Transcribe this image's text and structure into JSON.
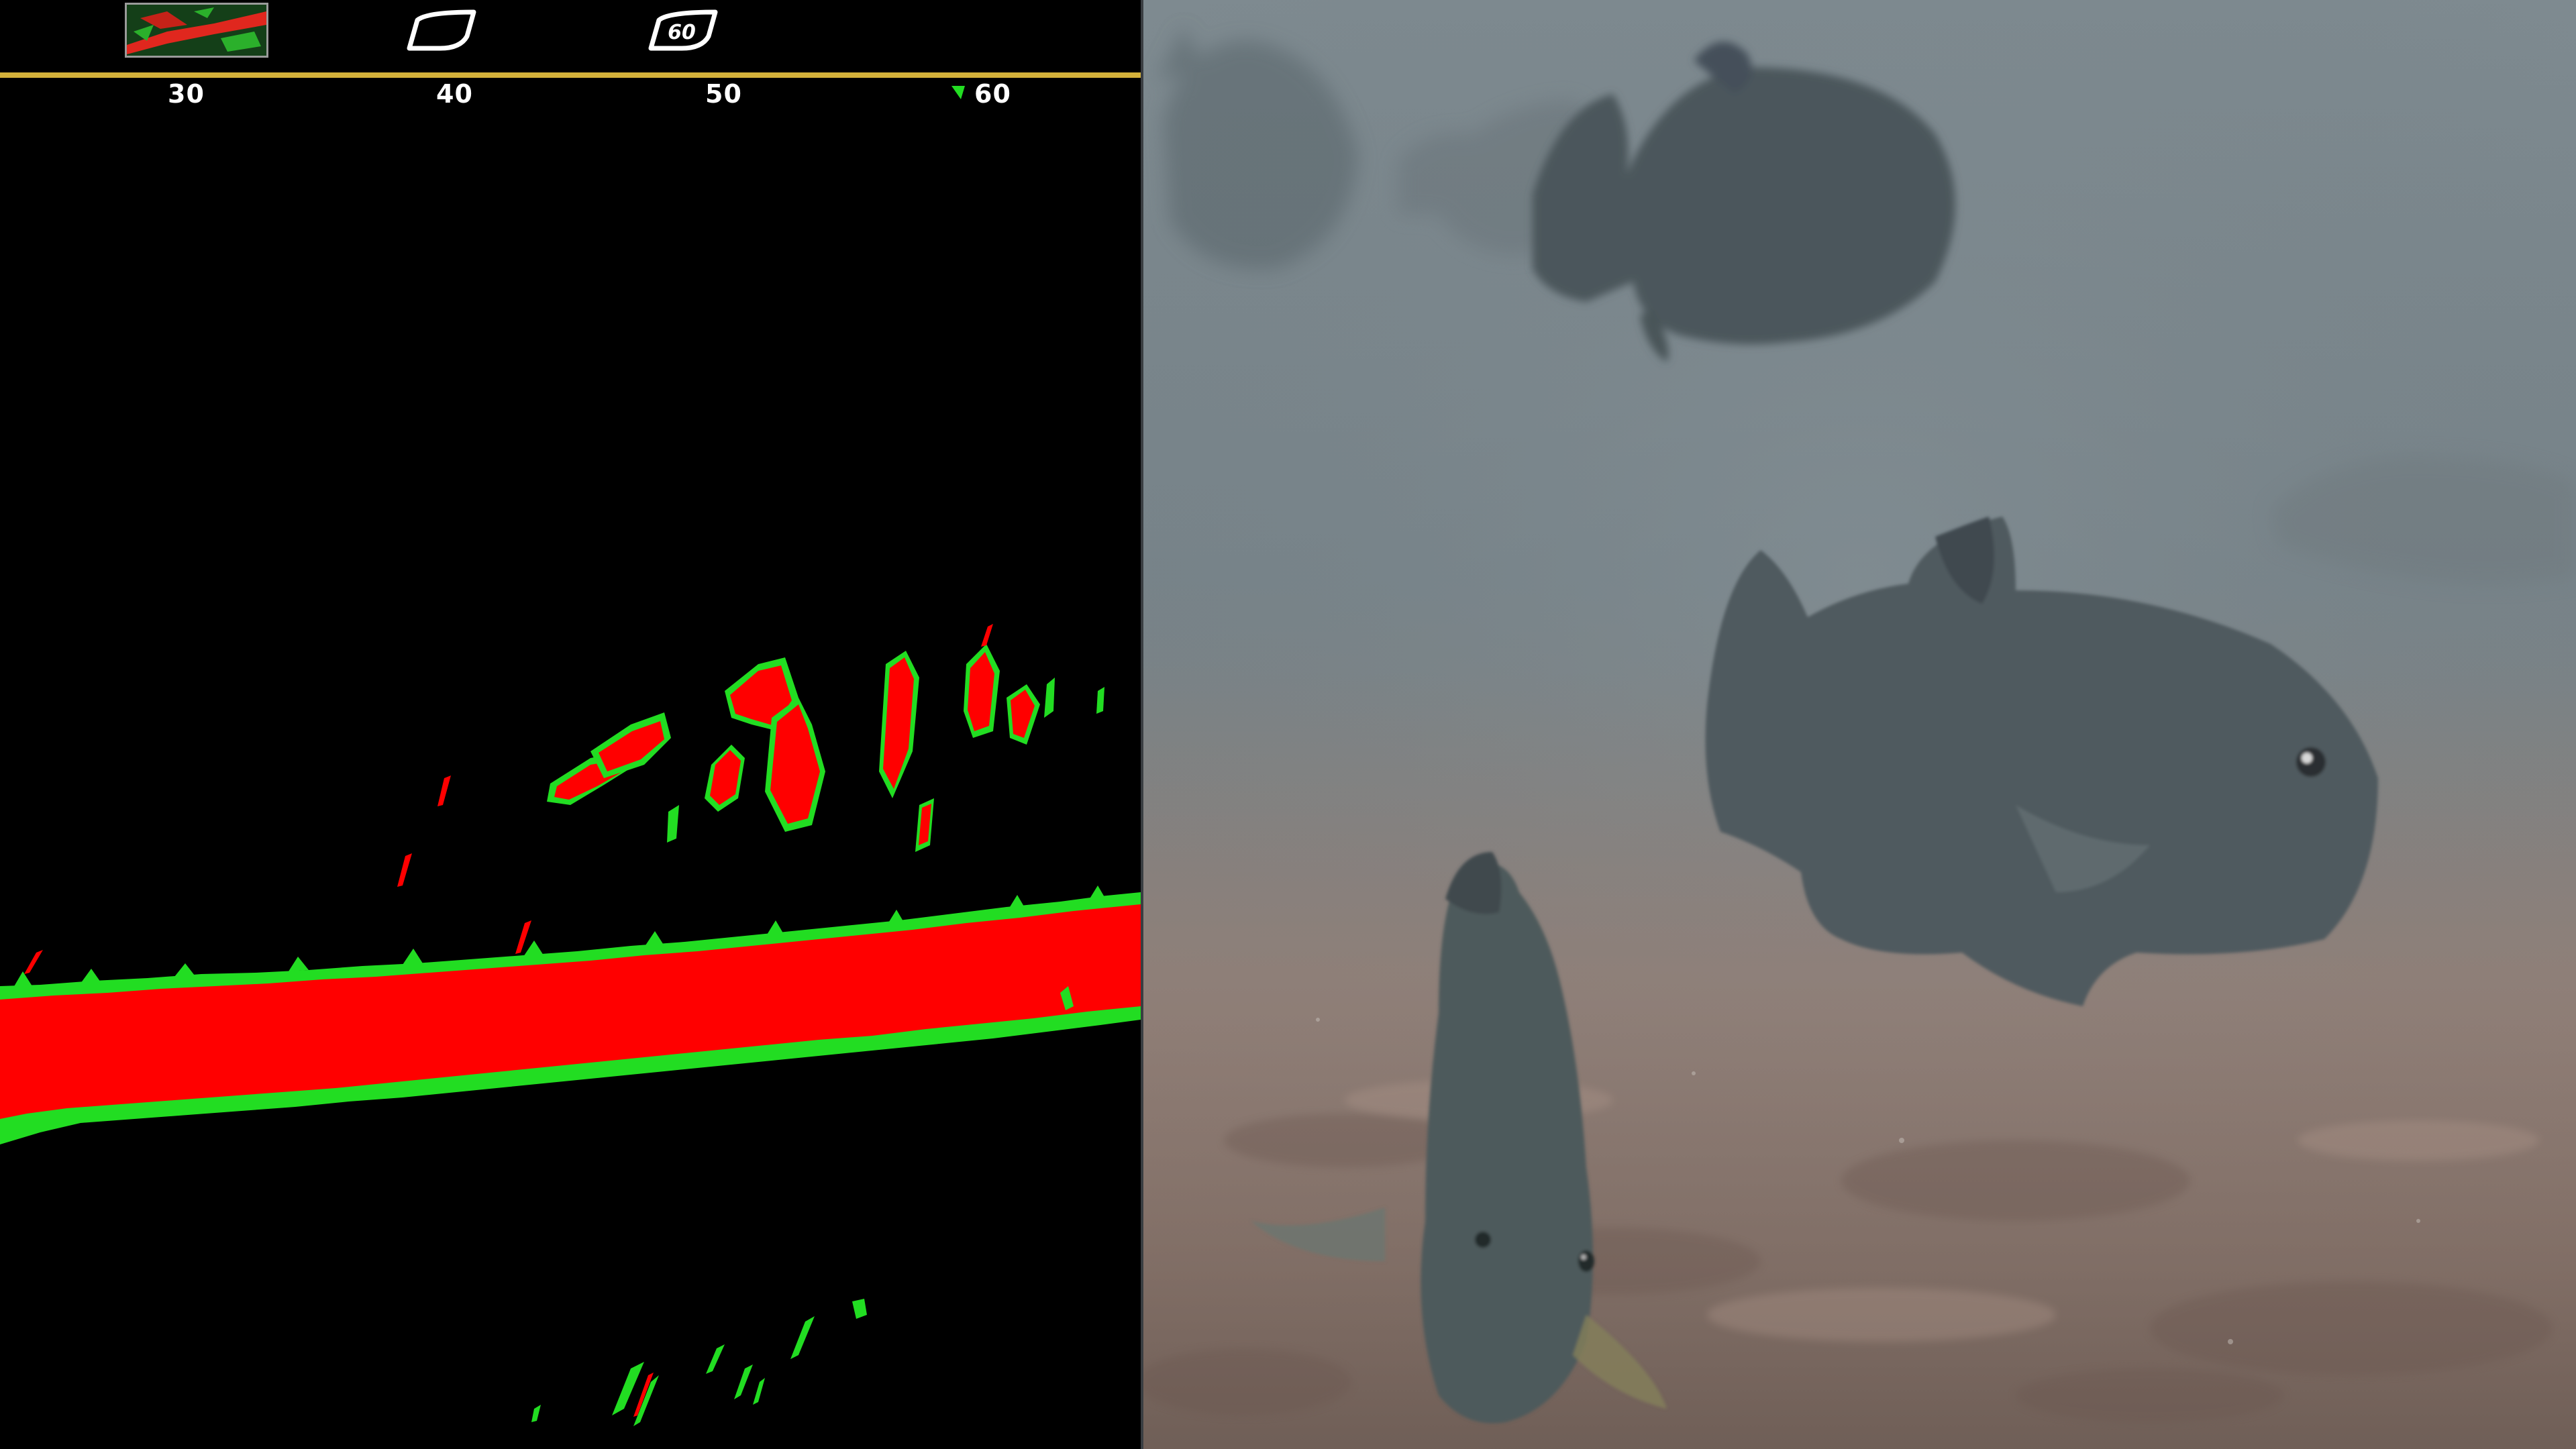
{
  "sonar": {
    "colors": {
      "background": "#000000",
      "scale_bar": "#d4b13a",
      "return_strong": "#ff0000",
      "return_edge": "#22dd22",
      "label": "#ffffff"
    },
    "scale_labels": [
      "30",
      "40",
      "50",
      "60"
    ],
    "mode_icons": [
      {
        "name": "sonar-preview-thumbnail"
      },
      {
        "name": "beam-shape-icon"
      },
      {
        "name": "beam-60-icon",
        "text": "60"
      }
    ]
  },
  "camera": {
    "scene": "underwater-fish-school",
    "colors": {
      "water": "#7f8b91",
      "sediment": "#8c7a72",
      "fish": "#4c5558"
    }
  }
}
